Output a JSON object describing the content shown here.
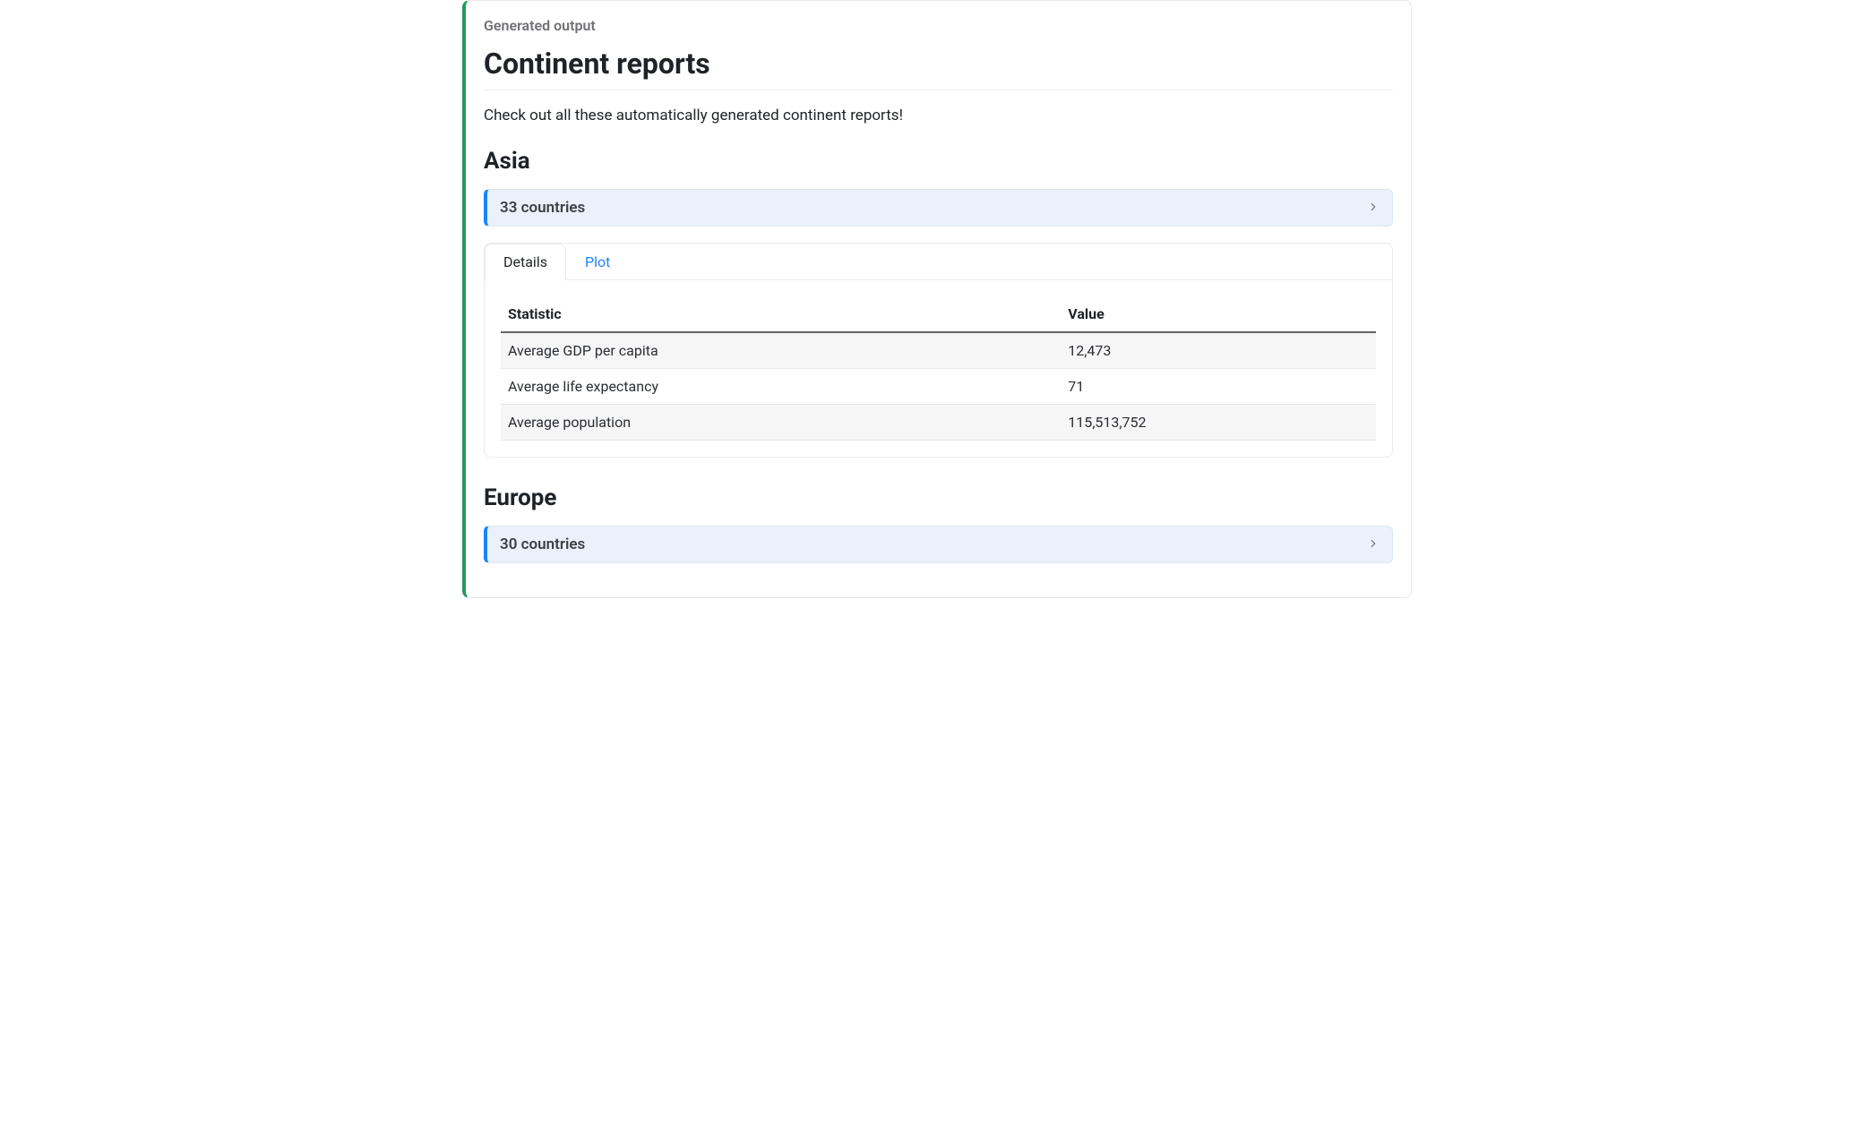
{
  "output_label": "Generated output",
  "title": "Continent reports",
  "intro": "Check out all these automatically generated continent reports!",
  "tabs": {
    "details": "Details",
    "plot": "Plot"
  },
  "table_headers": {
    "stat": "Statistic",
    "value": "Value"
  },
  "sections": [
    {
      "name": "Asia",
      "countries_label": "33 countries",
      "stats": [
        {
          "stat": "Average GDP per capita",
          "value": "12,473"
        },
        {
          "stat": "Average life expectancy",
          "value": "71"
        },
        {
          "stat": "Average population",
          "value": "115,513,752"
        }
      ]
    },
    {
      "name": "Europe",
      "countries_label": "30 countries",
      "stats": []
    }
  ]
}
